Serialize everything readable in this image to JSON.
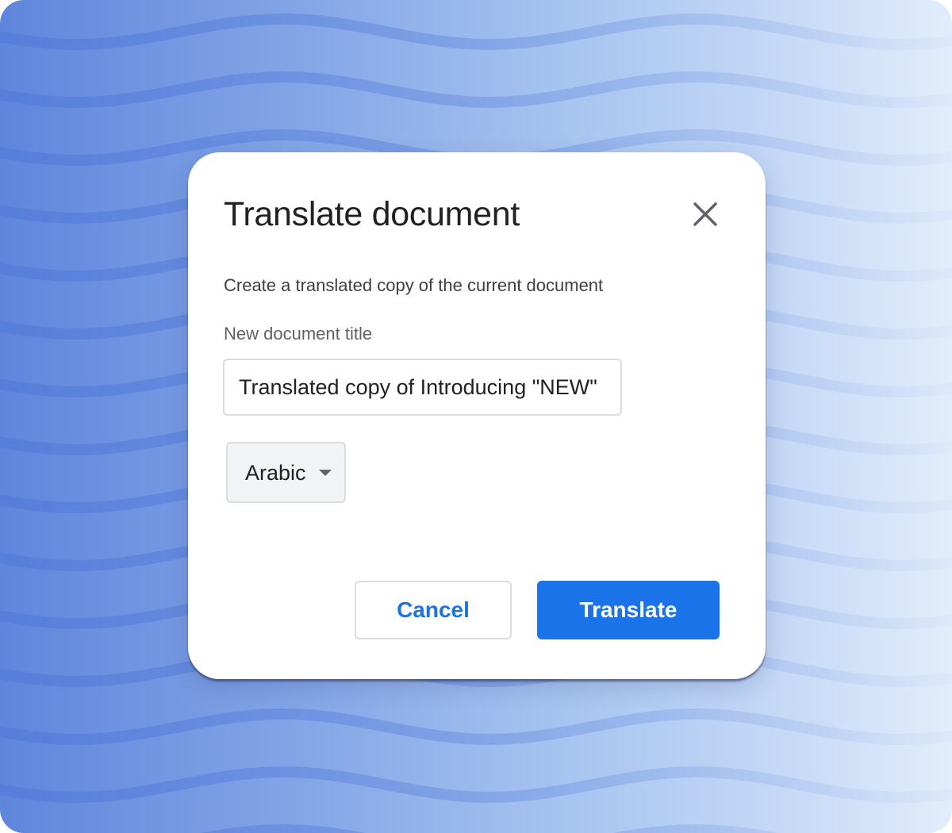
{
  "dialog": {
    "title": "Translate document",
    "close_icon": "close-icon",
    "description": "Create a translated copy of the current document",
    "field_label": "New document title",
    "title_value": "Translated copy of Introducing \"NEW\"",
    "language": {
      "selected": "Arabic",
      "icon": "chevron-down-icon"
    },
    "cancel_label": "Cancel",
    "translate_label": "Translate"
  },
  "colors": {
    "accent": "#1a73e8",
    "background_start": "#5f86dc",
    "background_end": "#e2edfb",
    "wave_line": "#4f78d8"
  }
}
